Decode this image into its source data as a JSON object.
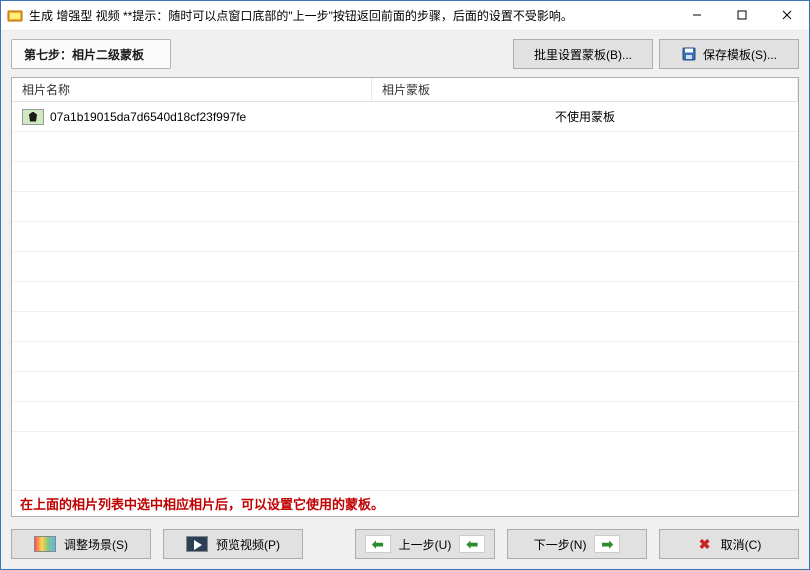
{
  "titlebar": {
    "text": "生成 增强型 视频  **提示：随时可以点窗口底部的\"上一步\"按钮返回前面的步骤，后面的设置不受影响。"
  },
  "top": {
    "step_label": "第七步：相片二级蒙板",
    "batch_mask_label": "批里设置蒙板(B)...",
    "save_template_label": "保存模板(S)..."
  },
  "list": {
    "col_name": "相片名称",
    "col_mask": "相片蒙板",
    "rows": [
      {
        "name": "07a1b19015da7d6540d18cf23f997fe",
        "mask": "不使用蒙板"
      }
    ]
  },
  "hint": "在上面的相片列表中选中相应相片后，可以设置它使用的蒙板。",
  "bottom": {
    "adjust_scene": "调整场景(S)",
    "preview_video": "预览视频(P)",
    "prev_step": "上一步(U)",
    "next_step": "下一步(N)",
    "cancel": "取消(C)"
  }
}
